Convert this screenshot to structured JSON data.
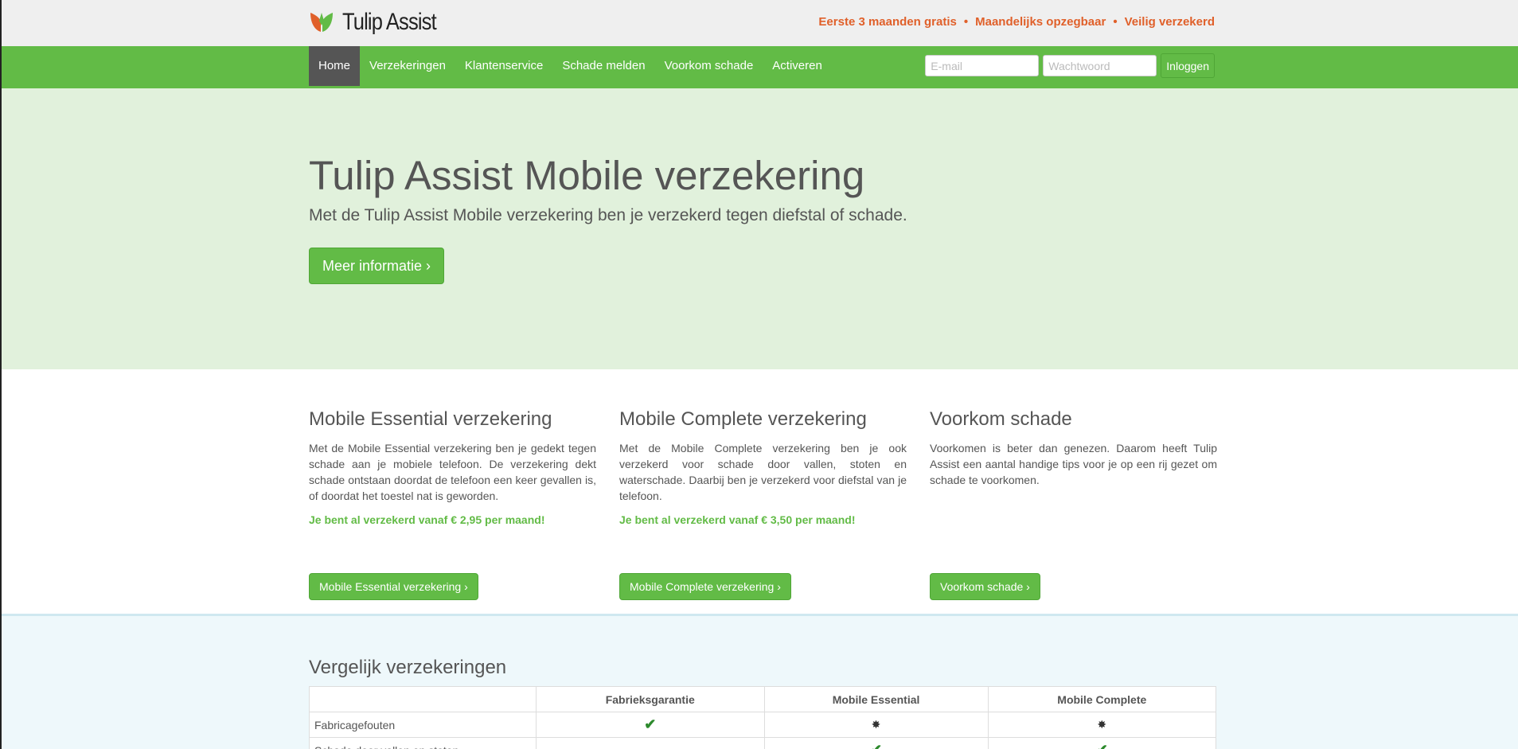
{
  "brand": {
    "name": "Tulip Assist"
  },
  "usps": [
    "Eerste 3 maanden gratis",
    "Maandelijks opzegbaar",
    "Veilig verzekerd"
  ],
  "usp_separator": "•",
  "nav": {
    "items": [
      "Home",
      "Verzekeringen",
      "Klantenservice",
      "Schade melden",
      "Voorkom schade",
      "Activeren"
    ],
    "active": "Home"
  },
  "login": {
    "email_placeholder": "E-mail",
    "email_value": "",
    "password_placeholder": "Wachtwoord",
    "password_value": "",
    "button_label": "Inloggen"
  },
  "hero": {
    "title": "Tulip Assist Mobile verzekering",
    "subtitle": "Met de Tulip Assist Mobile verzekering ben je verzekerd tegen diefstal of schade.",
    "cta_label": "Meer informatie ›"
  },
  "features": [
    {
      "title": "Mobile Essential verzekering",
      "text": "Met de Mobile Essential verzekering ben je gedekt tegen schade aan je mobiele telefoon. De verzekering dekt schade ontstaan doordat de telefoon een keer gevallen is, of doordat het toestel nat is geworden.",
      "price": "Je bent al verzekerd vanaf € 2,95 per maand!",
      "button": "Mobile Essential verzekering ›"
    },
    {
      "title": "Mobile Complete verzekering",
      "text": "Met de Mobile Complete verzekering ben je ook verzekerd voor schade door vallen, stoten en waterschade. Daarbij ben je verzekerd voor diefstal van je telefoon.",
      "price": "Je bent al verzekerd vanaf € 3,50 per maand!",
      "button": "Mobile Complete verzekering ›"
    },
    {
      "title": "Voorkom schade",
      "text": "Voorkomen is beter dan genezen. Daarom heeft Tulip Assist een aantal handige tips voor je op een rij gezet om schade te voorkomen.",
      "price": "",
      "button": "Voorkom schade ›"
    }
  ],
  "compare": {
    "title": "Vergelijk verzekeringen",
    "headers": [
      "",
      "Fabrieksgarantie",
      "Mobile Essential",
      "Mobile Complete"
    ],
    "rows": [
      {
        "label": "Fabricagefouten",
        "cells": [
          "check-icon",
          "star-icon",
          "star-icon"
        ]
      },
      {
        "label": "Schade door vallen en stoten",
        "cells": [
          "",
          "check-icon",
          "check-icon"
        ]
      }
    ]
  },
  "colors": {
    "green": "#62bb46",
    "hero_bg": "#e1f1dc",
    "usp_orange": "#e0602a",
    "compare_bg": "#eef8fb"
  }
}
